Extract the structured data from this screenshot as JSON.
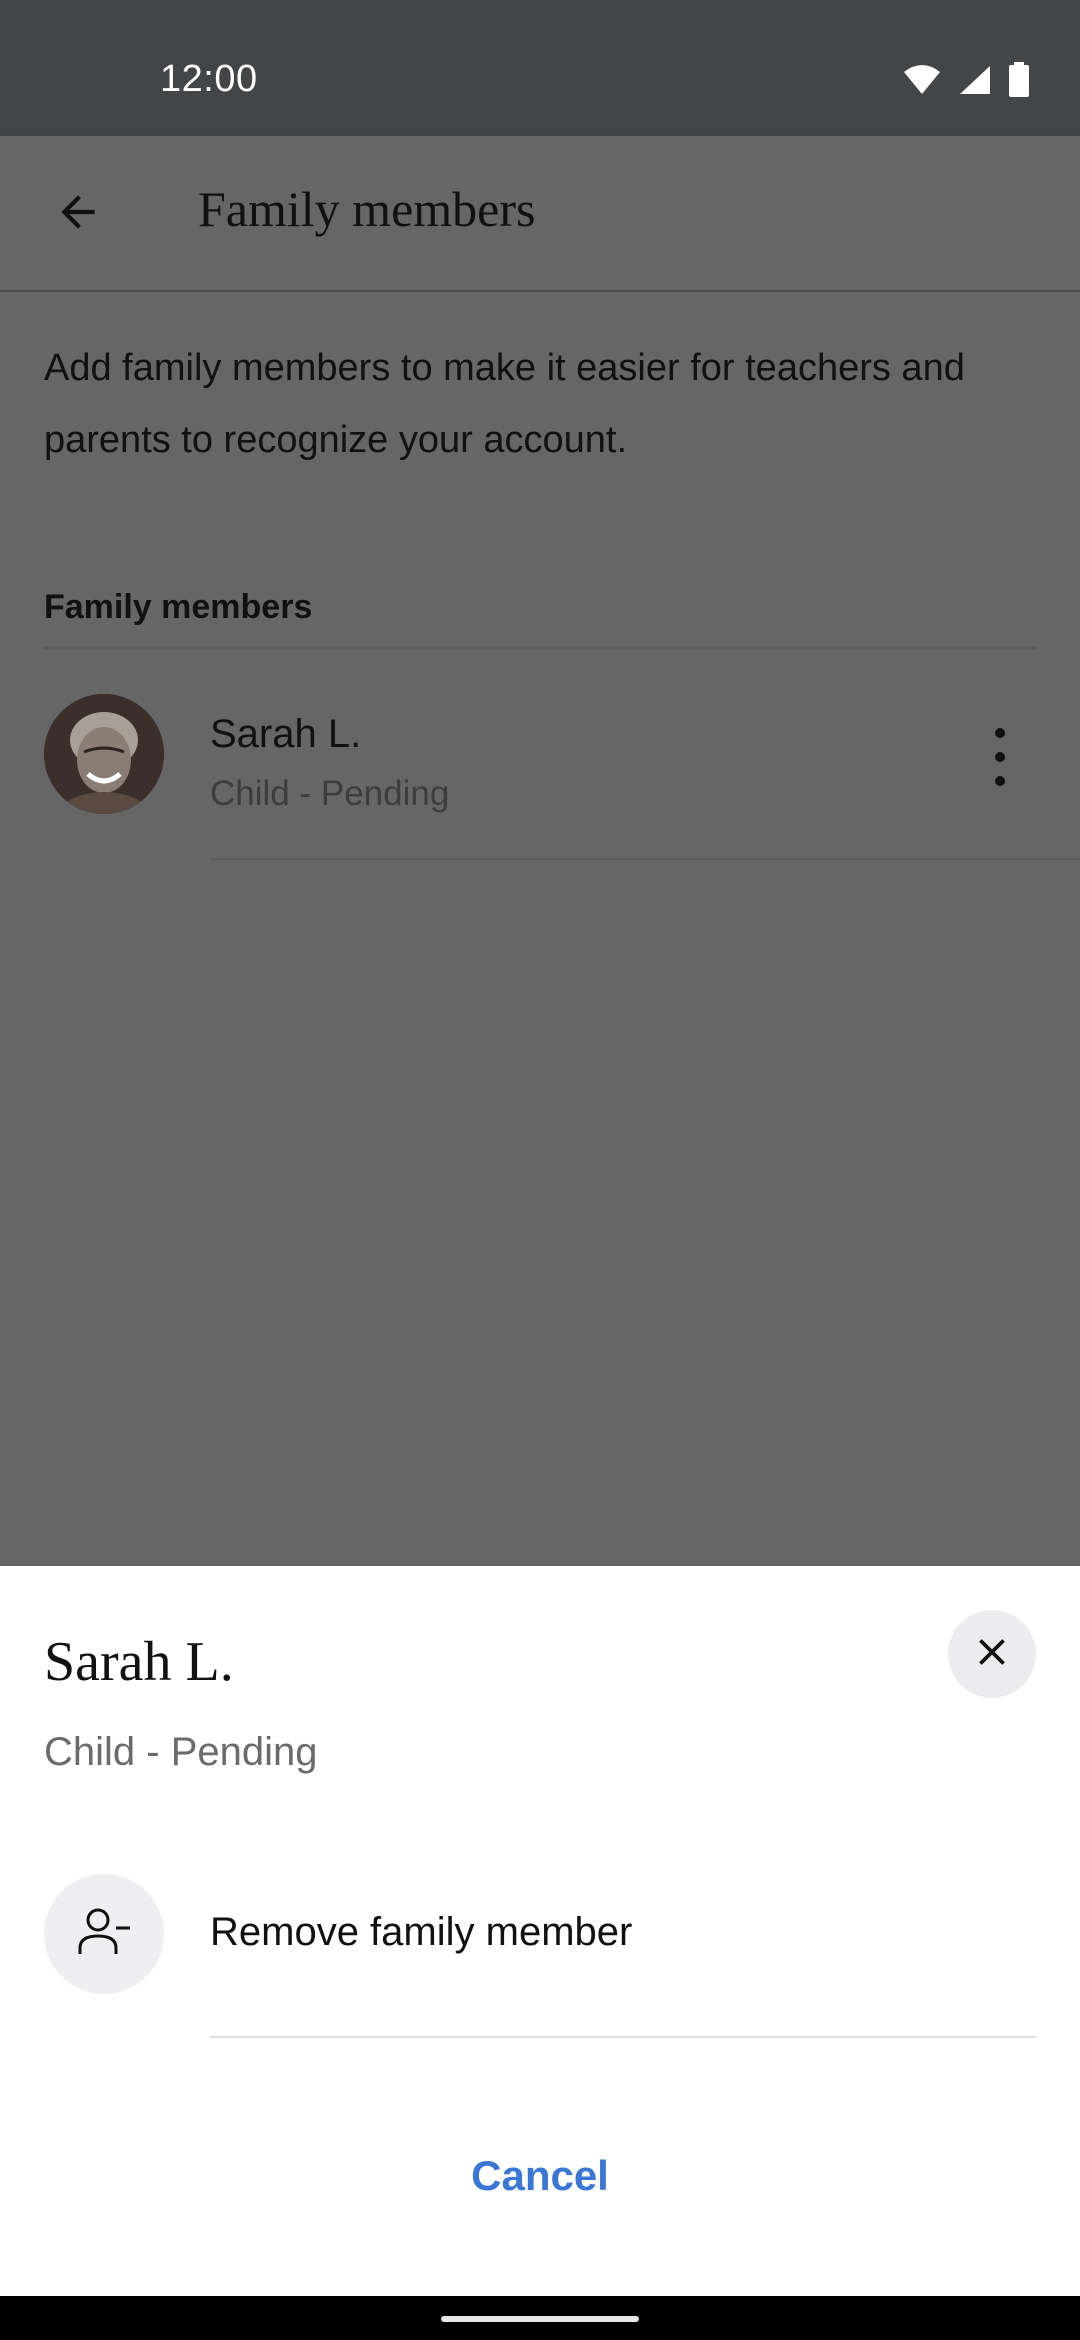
{
  "status_bar": {
    "time": "12:00",
    "icons": [
      "wifi-icon",
      "signal-icon",
      "battery-icon"
    ]
  },
  "app_bar": {
    "title": "Family members",
    "back_icon": "arrow-left-icon"
  },
  "content": {
    "intro": "Add family members to make it easier for teachers and parents to recognize your account.",
    "section_header": "Family members",
    "members": [
      {
        "name": "Sarah L.",
        "status": "Child - Pending",
        "menu_icon": "more-vert-icon"
      }
    ]
  },
  "sheet": {
    "title": "Sarah L.",
    "subtitle": "Child - Pending",
    "close_icon": "close-icon",
    "actions": [
      {
        "label": "Remove family member",
        "icon": "person-remove-icon"
      }
    ],
    "cancel_label": "Cancel"
  },
  "colors": {
    "accent": "#3b77d6",
    "scrim_background": "#666666",
    "status_bar": "#444547"
  }
}
